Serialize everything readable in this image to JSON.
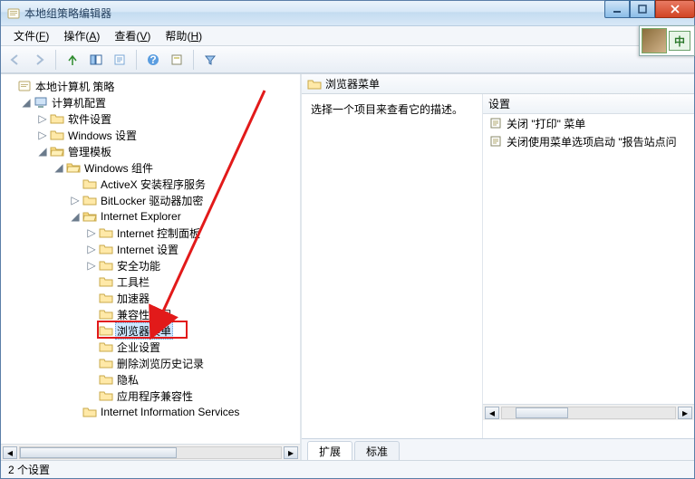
{
  "window": {
    "title": "本地组策略编辑器"
  },
  "menubar": {
    "file": {
      "label": "文件",
      "hotkey": "F"
    },
    "action": {
      "label": "操作",
      "hotkey": "A"
    },
    "view": {
      "label": "查看",
      "hotkey": "V"
    },
    "help": {
      "label": "帮助",
      "hotkey": "H"
    }
  },
  "ime": {
    "text": "中"
  },
  "tree": {
    "root": "本地计算机 策略",
    "computerCfg": "计算机配置",
    "software": "软件设置",
    "windowsSettings": "Windows 设置",
    "adminTemplates": "管理模板",
    "winComponents": "Windows 组件",
    "activex": "ActiveX 安装程序服务",
    "bitlocker": "BitLocker 驱动器加密",
    "ie": "Internet Explorer",
    "ieCP": "Internet 控制面板",
    "ieSettings": "Internet 设置",
    "security": "安全功能",
    "toolbars": "工具栏",
    "accelerators": "加速器",
    "compatView": "兼容性视图",
    "browserMenus": "浏览器菜单",
    "corpSettings": "企业设置",
    "deleteHistory": "删除浏览历史记录",
    "privacy": "隐私",
    "appCompat": "应用程序兼容性",
    "iis": "Internet Information Services"
  },
  "rightHeader": {
    "title": "浏览器菜单",
    "desc": "选择一个项目来查看它的描述。",
    "colSettings": "设置"
  },
  "settings": [
    "关闭 \"打印\" 菜单",
    "关闭使用菜单选项启动 \"报告站点问"
  ],
  "tabs": {
    "extended": "扩展",
    "standard": "标准"
  },
  "status": "2 个设置"
}
